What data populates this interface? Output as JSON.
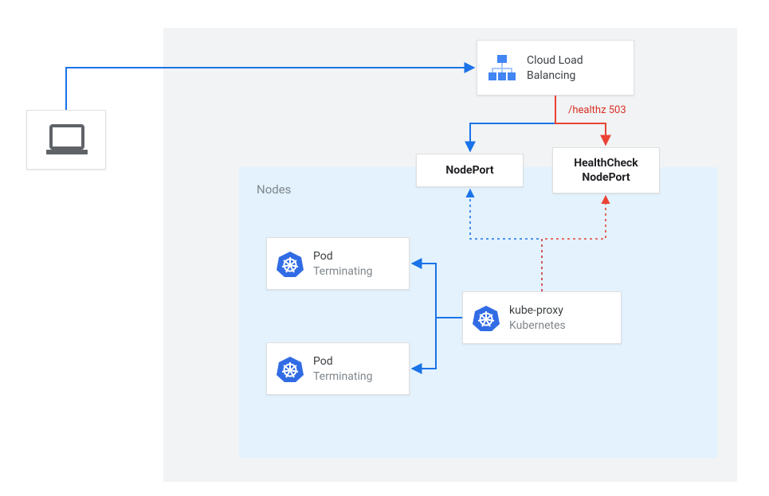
{
  "diagram": {
    "background_label": "Nodes",
    "healthz_label": "/healthz 503",
    "boxes": {
      "clb": {
        "title": "Cloud Load",
        "subtitle": "Balancing"
      },
      "nodeport": {
        "title": "NodePort"
      },
      "hcnodeport": {
        "title_line1": "HealthCheck",
        "title_line2": "NodePort"
      },
      "pod1": {
        "title": "Pod",
        "subtitle": "Terminating"
      },
      "pod2": {
        "title": "Pod",
        "subtitle": "Terminating"
      },
      "kubeproxy": {
        "title": "kube-proxy",
        "subtitle": "Kubernetes"
      }
    },
    "colors": {
      "blue": "#1a73e8",
      "red": "#ea4335",
      "blue_icon": "#4285f4",
      "k8s_blue": "#326ce5",
      "gray_text": "#80868b"
    }
  }
}
